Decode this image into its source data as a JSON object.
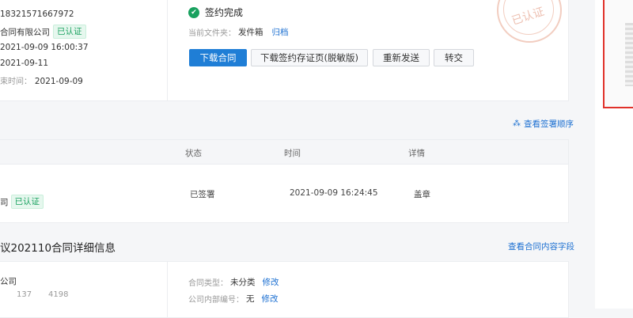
{
  "info": {
    "phone": "18321571667972",
    "company": "合同有限公司",
    "verified_tag": "已认证",
    "time1": "2021-09-09 16:00:37",
    "date2": "2021-09-11",
    "end_label": "束时间：",
    "end_value": "2021-09-09"
  },
  "status": {
    "title": "签约完成",
    "folder_label": "当前文件夹：",
    "folder_value": "发件箱",
    "archive_link": "归档",
    "seal_text": "已认证"
  },
  "actions": {
    "download": "下载合同",
    "download_cert": "下载签约存证页(脱敏版)",
    "resend": "重新发送",
    "transfer": "转交"
  },
  "sign_order_link": "查看签署顺序",
  "sign_table": {
    "headers": [
      "状态",
      "时间",
      "详情"
    ],
    "row": {
      "name": "司",
      "tag": "已认证",
      "status": "已签署",
      "time": "2021-09-09 16:24:45",
      "detail": "盖章"
    }
  },
  "details": {
    "title": "议202110合同详细信息",
    "view_fields_link": "查看合同内容字段",
    "company": "公司",
    "num1": "137",
    "num2": "4198",
    "type_label": "合同类型：",
    "type_value": "未分类",
    "type_edit": "修改",
    "code_label": "公司内部编号：",
    "code_value": "无",
    "code_edit": "修改"
  }
}
